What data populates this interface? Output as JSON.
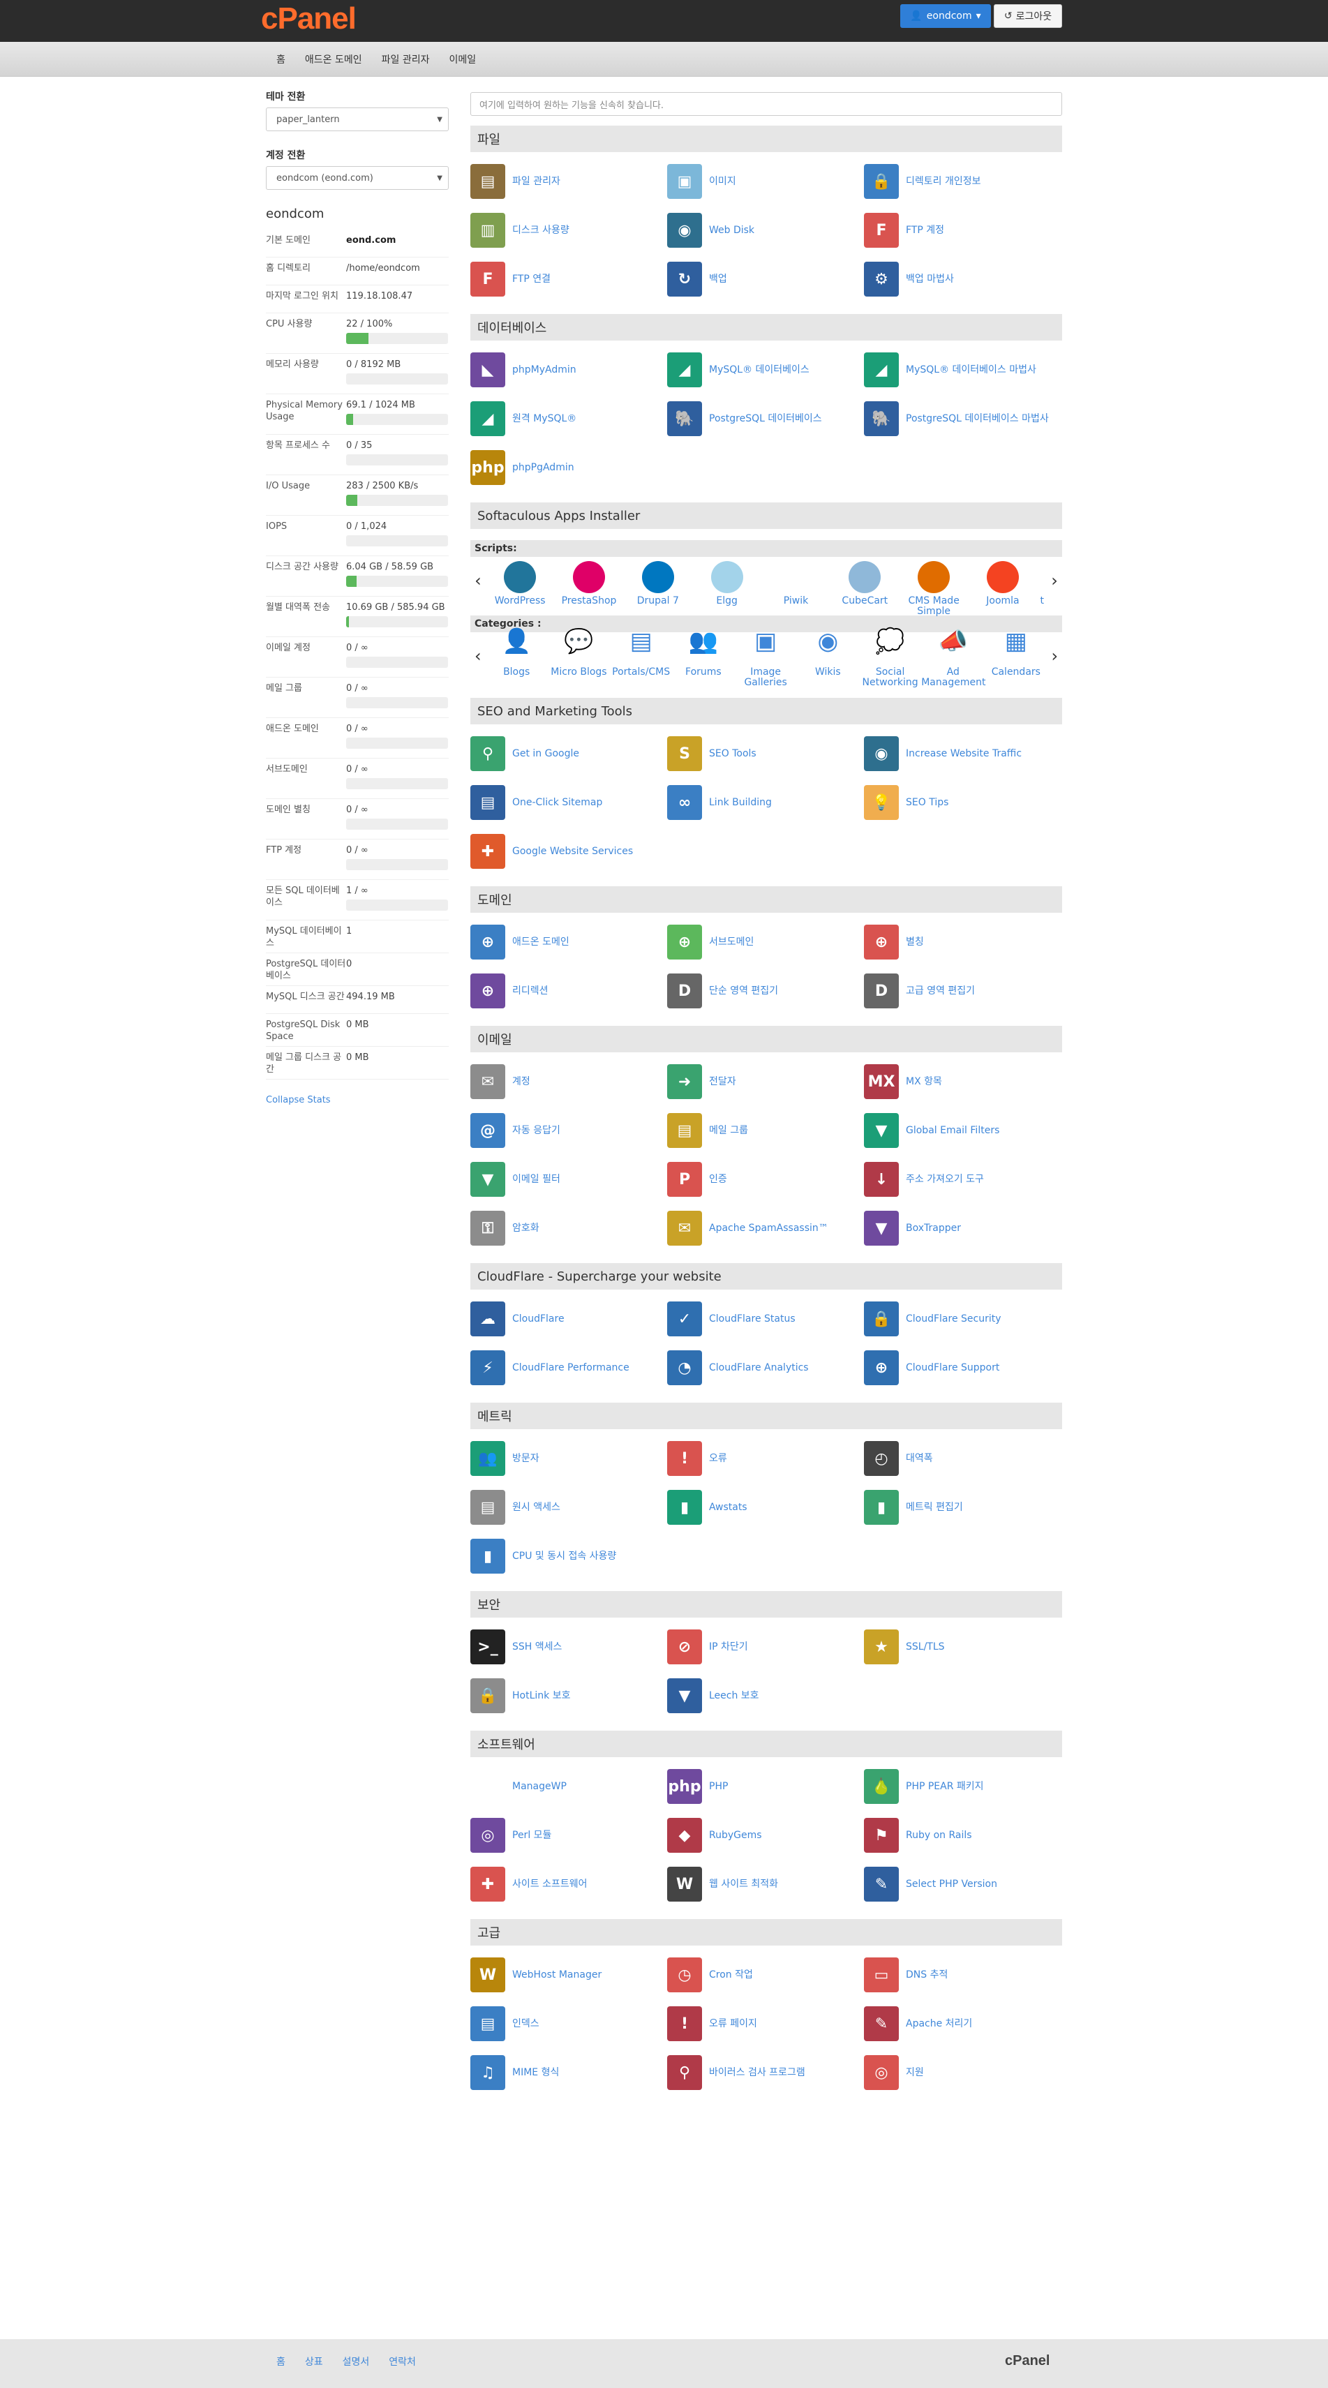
{
  "header": {
    "logo": "cPanel",
    "user": "eondcom",
    "logout": "로그아웃"
  },
  "nav": [
    "홈",
    "애드온 도메인",
    "파일 관리자",
    "이메일"
  ],
  "sidebar": {
    "theme_label": "테마 전환",
    "theme_value": "paper_lantern",
    "account_label": "계정 전환",
    "account_value": "eondcom (eond.com)",
    "title": "eondcom",
    "stats": [
      {
        "label": "기본 도메인",
        "value": "eond.com",
        "bold": true
      },
      {
        "label": "홈 디렉토리",
        "value": "/home/eondcom"
      },
      {
        "label": "마지막 로그인 위치",
        "value": "119.18.108.47"
      },
      {
        "label": "CPU 사용량",
        "value": "22 / 100%",
        "fill": 0.22
      },
      {
        "label": "메모리 사용량",
        "value": "0 / 8192 MB",
        "fill": 0
      },
      {
        "label": "Physical Memory Usage",
        "value": "69.1 / 1024 MB",
        "fill": 0.07
      },
      {
        "label": "항목 프로세스 수",
        "value": "0 / 35",
        "fill": 0
      },
      {
        "label": "I/O Usage",
        "value": "283 / 2500 KB/s",
        "fill": 0.11
      },
      {
        "label": "IOPS",
        "value": "0 / 1,024",
        "fill": 0
      },
      {
        "label": "디스크 공간 사용량",
        "value": "6.04 GB / 58.59 GB",
        "fill": 0.1
      },
      {
        "label": "월별 대역폭 전송",
        "value": "10.69 GB / 585.94 GB",
        "fill": 0.02
      },
      {
        "label": "이메일 계정",
        "value": "0 / ∞",
        "fill": 0
      },
      {
        "label": "메일 그룹",
        "value": "0 / ∞",
        "fill": 0
      },
      {
        "label": "애드온 도메인",
        "value": "0 / ∞",
        "fill": 0
      },
      {
        "label": "서브도메인",
        "value": "0 / ∞",
        "fill": 0
      },
      {
        "label": "도메인 별칭",
        "value": "0 / ∞",
        "fill": 0
      },
      {
        "label": "FTP 계정",
        "value": "0 / ∞",
        "fill": 0
      },
      {
        "label": "모든 SQL 데이터베이스",
        "value": "1 / ∞",
        "fill": 0
      },
      {
        "label": "MySQL 데이터베이스",
        "value": "1"
      },
      {
        "label": "PostgreSQL 데이터베이스",
        "value": "0"
      },
      {
        "label": "MySQL 디스크 공간",
        "value": "494.19 MB"
      },
      {
        "label": "PostgreSQL Disk Space",
        "value": "0 MB"
      },
      {
        "label": "메일 그룹 디스크 공간",
        "value": "0 MB"
      }
    ],
    "collapse": "Collapse Stats"
  },
  "search_placeholder": "여기에 입력하여 원하는 기능을 신속히 찾습니다.",
  "sections_a": [
    {
      "title": "파일",
      "items": [
        {
          "label": "파일 관리자",
          "color": "#8a6d3b",
          "glyph": "▤"
        },
        {
          "label": "이미지",
          "color": "#7cb7d9",
          "glyph": "▣"
        },
        {
          "label": "디렉토리 개인정보",
          "color": "#3b7fc4",
          "glyph": "🔒"
        },
        {
          "label": "디스크 사용량",
          "color": "#7f9f4f",
          "glyph": "▥"
        },
        {
          "label": "Web Disk",
          "color": "#2e6f8e",
          "glyph": "◉"
        },
        {
          "label": "FTP 계정",
          "color": "#d9534f",
          "glyph": "F"
        },
        {
          "label": "FTP 연결",
          "color": "#d9534f",
          "glyph": "F"
        },
        {
          "label": "백업",
          "color": "#2f5f9e",
          "glyph": "↻"
        },
        {
          "label": "백업 마법사",
          "color": "#2f5f9e",
          "glyph": "⚙"
        }
      ]
    },
    {
      "title": "데이터베이스",
      "items": [
        {
          "label": "phpMyAdmin",
          "color": "#6f4a9e",
          "glyph": "◣"
        },
        {
          "label": "MySQL® 데이터베이스",
          "color": "#1b9e77",
          "glyph": "◢"
        },
        {
          "label": "MySQL® 데이터베이스 마법사",
          "color": "#1b9e77",
          "glyph": "◢"
        },
        {
          "label": "원격 MySQL®",
          "color": "#1b9e77",
          "glyph": "◢"
        },
        {
          "label": "PostgreSQL 데이터베이스",
          "color": "#2f5f9e",
          "glyph": "🐘"
        },
        {
          "label": "PostgreSQL 데이터베이스 마법사",
          "color": "#2f5f9e",
          "glyph": "🐘"
        },
        {
          "label": "phpPgAdmin",
          "color": "#b8860b",
          "glyph": "php"
        }
      ]
    }
  ],
  "softaculous": {
    "title": "Softaculous Apps Installer",
    "scripts_label": "Scripts:",
    "scripts": [
      {
        "label": "WordPress",
        "color": "#21759b"
      },
      {
        "label": "PrestaShop",
        "color": "#df0067"
      },
      {
        "label": "Drupal 7",
        "color": "#0077c0"
      },
      {
        "label": "Elgg",
        "color": "#a3d3ea"
      },
      {
        "label": "Piwik",
        "color": "#ffffff"
      },
      {
        "label": "CubeCart",
        "color": "#8fb8d9"
      },
      {
        "label": "CMS Made Simple",
        "color": "#e06c00"
      },
      {
        "label": "Joomla",
        "color": "#f44321"
      }
    ],
    "scripts_more": "t",
    "categories_label": "Categories :",
    "categories": [
      {
        "label": "Blogs",
        "glyph": "👤"
      },
      {
        "label": "Micro Blogs",
        "glyph": "💬"
      },
      {
        "label": "Portals/CMS",
        "glyph": "▤"
      },
      {
        "label": "Forums",
        "glyph": "👥"
      },
      {
        "label": "Image Galleries",
        "glyph": "▣"
      },
      {
        "label": "Wikis",
        "glyph": "◉"
      },
      {
        "label": "Social Networking",
        "glyph": "💭"
      },
      {
        "label": "Ad Management",
        "glyph": "📣"
      },
      {
        "label": "Calendars",
        "glyph": "▦"
      }
    ]
  },
  "sections_b": [
    {
      "title": "SEO and Marketing Tools",
      "items": [
        {
          "label": "Get in Google",
          "color": "#3aa36f",
          "glyph": "⚲"
        },
        {
          "label": "SEO Tools",
          "color": "#c9a227",
          "glyph": "S"
        },
        {
          "label": "Increase Website Traffic",
          "color": "#2e6f8e",
          "glyph": "◉"
        },
        {
          "label": "One-Click Sitemap",
          "color": "#2f5f9e",
          "glyph": "▤"
        },
        {
          "label": "Link Building",
          "color": "#3b7fc4",
          "glyph": "∞"
        },
        {
          "label": "SEO Tips",
          "color": "#f0ad4e",
          "glyph": "💡"
        },
        {
          "label": "Google Website Services",
          "color": "#e05a2b",
          "glyph": "✚"
        }
      ]
    },
    {
      "title": "도메인",
      "items": [
        {
          "label": "애드온 도메인",
          "color": "#3b7fc4",
          "glyph": "⊕"
        },
        {
          "label": "서브도메인",
          "color": "#5cb85c",
          "glyph": "⊕"
        },
        {
          "label": "별칭",
          "color": "#d9534f",
          "glyph": "⊕"
        },
        {
          "label": "리디렉션",
          "color": "#6f4a9e",
          "glyph": "⊕"
        },
        {
          "label": "단순 영역 편집기",
          "color": "#666666",
          "glyph": "D"
        },
        {
          "label": "고급 영역 편집기",
          "color": "#666666",
          "glyph": "D"
        }
      ]
    },
    {
      "title": "이메일",
      "items": [
        {
          "label": "계정",
          "color": "#8c8c8c",
          "glyph": "✉"
        },
        {
          "label": "전달자",
          "color": "#3aa36f",
          "glyph": "➜"
        },
        {
          "label": "MX 항목",
          "color": "#b03a48",
          "glyph": "MX"
        },
        {
          "label": "자동 응답기",
          "color": "#3b7fc4",
          "glyph": "@"
        },
        {
          "label": "메일 그룹",
          "color": "#c9a227",
          "glyph": "▤"
        },
        {
          "label": "Global Email Filters",
          "color": "#1b9e77",
          "glyph": "▼"
        },
        {
          "label": "이메일 필터",
          "color": "#3aa36f",
          "glyph": "▼"
        },
        {
          "label": "인증",
          "color": "#d9534f",
          "glyph": "P"
        },
        {
          "label": "주소 가져오기 도구",
          "color": "#b03a48",
          "glyph": "↓"
        },
        {
          "label": "암호화",
          "color": "#8c8c8c",
          "glyph": "⚿"
        },
        {
          "label": "Apache SpamAssassin™",
          "color": "#c9a227",
          "glyph": "✉"
        },
        {
          "label": "BoxTrapper",
          "color": "#6f4a9e",
          "glyph": "▼"
        }
      ]
    },
    {
      "title": "CloudFlare - Supercharge your website",
      "items": [
        {
          "label": "CloudFlare",
          "color": "#2f5f9e",
          "glyph": "☁"
        },
        {
          "label": "CloudFlare Status",
          "color": "#2f6fb0",
          "glyph": "✓"
        },
        {
          "label": "CloudFlare Security",
          "color": "#2f6fb0",
          "glyph": "🔒"
        },
        {
          "label": "CloudFlare Performance",
          "color": "#2f6fb0",
          "glyph": "⚡"
        },
        {
          "label": "CloudFlare Analytics",
          "color": "#2f6fb0",
          "glyph": "◔"
        },
        {
          "label": "CloudFlare Support",
          "color": "#2f6fb0",
          "glyph": "⊕"
        }
      ]
    },
    {
      "title": "메트릭",
      "items": [
        {
          "label": "방문자",
          "color": "#1b9e77",
          "glyph": "👥"
        },
        {
          "label": "오류",
          "color": "#d9534f",
          "glyph": "!"
        },
        {
          "label": "대역폭",
          "color": "#444444",
          "glyph": "◴"
        },
        {
          "label": "원시 액세스",
          "color": "#8c8c8c",
          "glyph": "▤"
        },
        {
          "label": "Awstats",
          "color": "#1b9e77",
          "glyph": "▮"
        },
        {
          "label": "메트릭 편집기",
          "color": "#3aa36f",
          "glyph": "▮"
        },
        {
          "label": "CPU 및 동시 접속 사용량",
          "color": "#3b7fc4",
          "glyph": "▮"
        }
      ]
    },
    {
      "title": "보안",
      "items": [
        {
          "label": "SSH 액세스",
          "color": "#222222",
          "glyph": ">_"
        },
        {
          "label": "IP 차단기",
          "color": "#d9534f",
          "glyph": "⊘"
        },
        {
          "label": "SSL/TLS",
          "color": "#c9a227",
          "glyph": "★"
        },
        {
          "label": "HotLink 보호",
          "color": "#8c8c8c",
          "glyph": "🔒"
        },
        {
          "label": "Leech 보호",
          "color": "#2f5f9e",
          "glyph": "▼"
        }
      ]
    },
    {
      "title": "소프트웨어",
      "items": [
        {
          "label": "ManageWP",
          "color": "#ffffff",
          "glyph": ""
        },
        {
          "label": "PHP",
          "color": "#6f4a9e",
          "glyph": "php"
        },
        {
          "label": "PHP PEAR 패키지",
          "color": "#3aa36f",
          "glyph": "🍐"
        },
        {
          "label": "Perl 모듈",
          "color": "#6f4a9e",
          "glyph": "◎"
        },
        {
          "label": "RubyGems",
          "color": "#b03a48",
          "glyph": "◆"
        },
        {
          "label": "Ruby on Rails",
          "color": "#b03a48",
          "glyph": "⚑"
        },
        {
          "label": "사이트 소프트웨어",
          "color": "#d9534f",
          "glyph": "✚"
        },
        {
          "label": "웹 사이트 최적화",
          "color": "#444444",
          "glyph": "W"
        },
        {
          "label": "Select PHP Version",
          "color": "#2f5f9e",
          "glyph": "✎"
        }
      ]
    },
    {
      "title": "고급",
      "items": [
        {
          "label": "WebHost Manager",
          "color": "#b8860b",
          "glyph": "W"
        },
        {
          "label": "Cron 작업",
          "color": "#d9534f",
          "glyph": "◷"
        },
        {
          "label": "DNS 추적",
          "color": "#d9534f",
          "glyph": "▭"
        },
        {
          "label": "인덱스",
          "color": "#3b7fc4",
          "glyph": "▤"
        },
        {
          "label": "오류 페이지",
          "color": "#b03a48",
          "glyph": "!"
        },
        {
          "label": "Apache 처리기",
          "color": "#b03a48",
          "glyph": "✎"
        },
        {
          "label": "MIME 형식",
          "color": "#3b7fc4",
          "glyph": "♫"
        },
        {
          "label": "바이러스 검사 프로그램",
          "color": "#b03a48",
          "glyph": "⚲"
        },
        {
          "label": "지원",
          "color": "#d9534f",
          "glyph": "◎"
        }
      ]
    }
  ],
  "footer": {
    "links": [
      "홈",
      "상표",
      "설명서",
      "연락처"
    ],
    "logo": "cPanel"
  }
}
